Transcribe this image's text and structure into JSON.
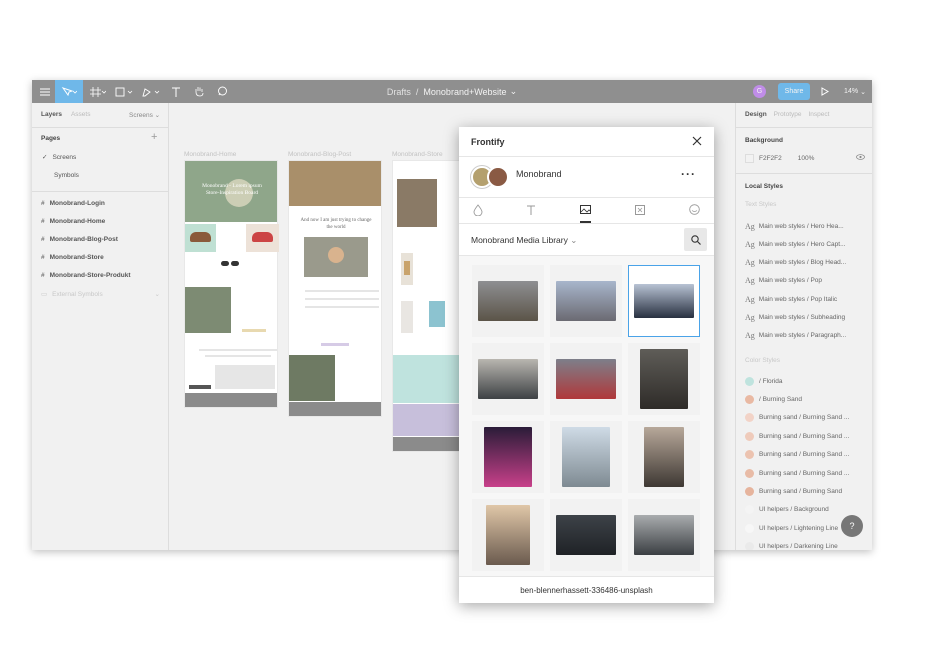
{
  "toolbar": {
    "breadcrumb_parent": "Drafts",
    "separator": "/",
    "file_name": "Monobrand+Website",
    "avatar_initial": "G",
    "share_label": "Share",
    "zoom": "14%"
  },
  "left_panel": {
    "tabs": [
      "Layers",
      "Assets"
    ],
    "screens_dropdown": "Screens",
    "pages_title": "Pages",
    "pages": [
      "Screens",
      "Symbols"
    ],
    "layers": [
      "Monobrand-Login",
      "Monobrand-Home",
      "Monobrand-Blog-Post",
      "Monobrand-Store",
      "Monobrand-Store-Produkt",
      "External Symbols"
    ]
  },
  "canvas": {
    "frames": [
      "Monobrand-Home",
      "Monobrand-Blog-Post",
      "Monobrand-Store"
    ],
    "home_hero_text": "Monobrand - Lorem ipsum Store-Inspiration Board",
    "blog_heading": "And now I am just trying to change the world"
  },
  "right_panel": {
    "tabs": [
      "Design",
      "Prototype",
      "Inspect"
    ],
    "background_title": "Background",
    "bg_color": "F2F2F2",
    "bg_opacity": "100%",
    "local_styles_title": "Local Styles",
    "text_styles_title": "Text Styles",
    "text_style_glyph": "Ag",
    "text_styles": [
      "Main web styles  / Hero Hea...",
      "Main web styles  / Hero Capt...",
      "Main web styles  / Blog Head...",
      "Main web styles  / Pop",
      "Main web styles  / Pop Italic",
      "Main web styles  / Subheading",
      "Main web styles  / Paragraph..."
    ],
    "color_styles_title": "Color Styles",
    "color_styles": [
      {
        "name": "/ Florida",
        "color": "#bfe3de"
      },
      {
        "name": "/ Burning Sand",
        "color": "#e9b9a3"
      },
      {
        "name": "Burning sand / Burning Sand ...",
        "color": "#f2d3c7"
      },
      {
        "name": "Burning sand / Burning Sand ...",
        "color": "#efcbbb"
      },
      {
        "name": "Burning sand / Burning Sand ...",
        "color": "#ecc3b0"
      },
      {
        "name": "Burning sand / Burning Sand ...",
        "color": "#e8bba6"
      },
      {
        "name": "Burning sand / Burning Sand",
        "color": "#e6b49d"
      },
      {
        "name": "UI helpers / Background",
        "color": "#f4f4f4"
      },
      {
        "name": "UI helpers / Lightening Line",
        "color": "#f7f7f7"
      },
      {
        "name": "UI helpers / Darkening Line",
        "color": "#eaeaea"
      }
    ],
    "help_label": "?"
  },
  "frontify": {
    "title": "Frontify",
    "brand_name": "Monobrand",
    "library_name": "Monobrand Media Library",
    "filename": "ben-blennerhassett-336486-unsplash",
    "thumbnails": [
      {
        "top": "#8e8f92",
        "bottom": "#5b5448"
      },
      {
        "top": "#a8b6cc",
        "bottom": "#6b6a72"
      },
      {
        "top": "#b8c3d4",
        "bottom": "#283040"
      },
      {
        "top": "#b9b6b0",
        "bottom": "#3d4144"
      },
      {
        "top": "#7d7f8a",
        "bottom": "#b0383a"
      },
      {
        "top": "#5f5d58",
        "bottom": "#2e2b28"
      },
      {
        "top": "#2a1c38",
        "bottom": "#c8408a"
      },
      {
        "top": "#cfdbe6",
        "bottom": "#7e8a92"
      },
      {
        "top": "#b7a89a",
        "bottom": "#3e3833"
      },
      {
        "top": "#e0c7a8",
        "bottom": "#6a5a4e"
      },
      {
        "top": "#3d4248",
        "bottom": "#1f2226"
      },
      {
        "top": "#a9acae",
        "bottom": "#3b3f43"
      }
    ]
  }
}
